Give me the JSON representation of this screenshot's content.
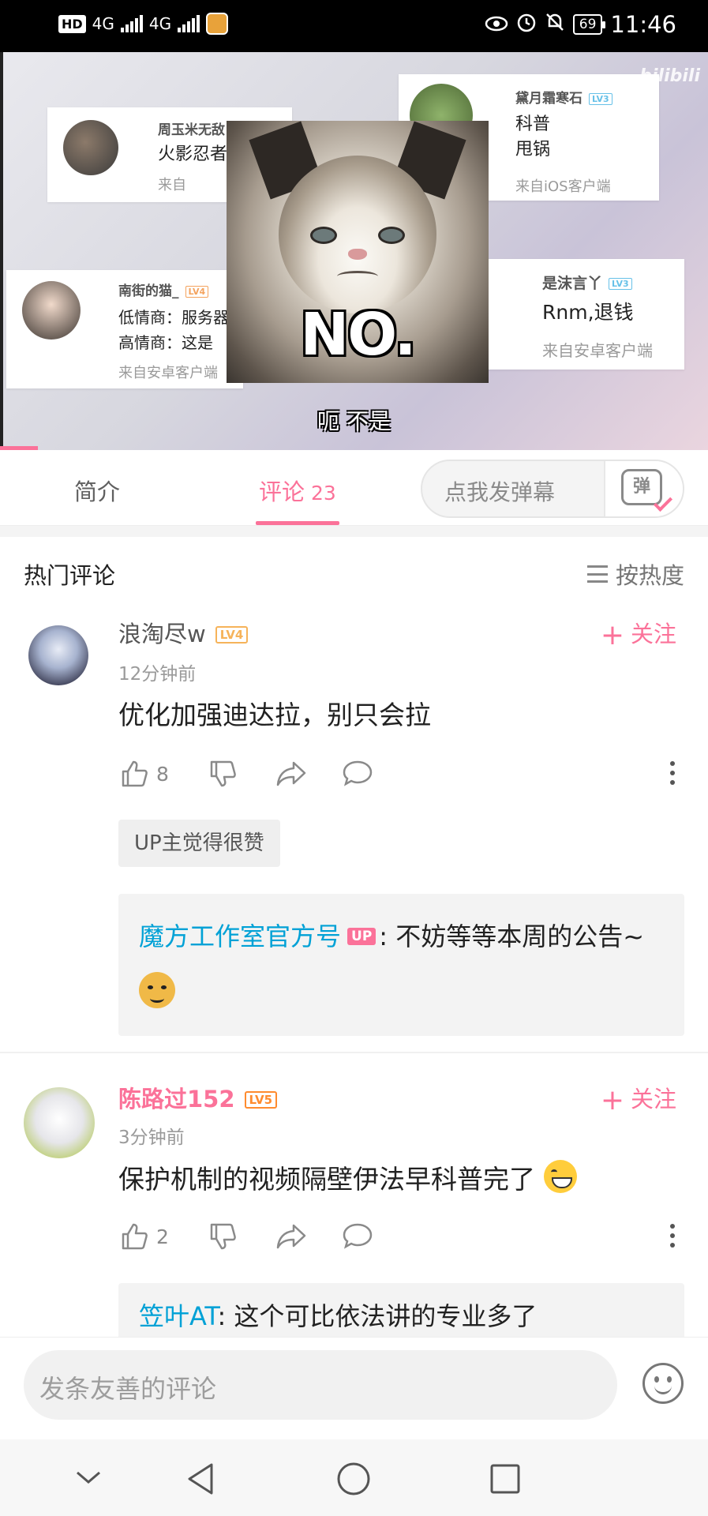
{
  "status_bar": {
    "left_badges": [
      "HD",
      "4G",
      "4G"
    ],
    "battery": "69",
    "time": "11:46",
    "icons": [
      "eye-icon",
      "alarm-icon",
      "bell-off-icon"
    ]
  },
  "video": {
    "subtitle": "呃 不是",
    "watermark": "bilibili",
    "meme_caption": "NO.",
    "progress_fraction": 0.054,
    "overlay_comments": [
      {
        "name": "周玉米无敌",
        "body": "火影忍者",
        "from": "来自"
      },
      {
        "name": "黛月霜寒石",
        "level": "LV3",
        "body_lines": [
          "科普",
          "甩锅"
        ],
        "from": "来自iOS客户端"
      },
      {
        "name": "南街的猫_",
        "level": "LV4",
        "body_lines": [
          "低情商：服务器",
          "高情商：这是"
        ],
        "from": "来自安卓客户端"
      },
      {
        "name": "是沫言丫",
        "level": "LV3",
        "body": "Rnm,退钱",
        "from": "来自安卓客户端"
      }
    ]
  },
  "tabs": {
    "intro": "简介",
    "comments": "评论",
    "comments_count": "23",
    "danmaku_placeholder": "点我发弹幕",
    "danmaku_switch": "弹"
  },
  "comments_header": {
    "title": "热门评论",
    "sort_label": "按热度"
  },
  "comments": [
    {
      "username": "浪淘尽w",
      "level": "LV4",
      "follow_label": "关注",
      "time": "12分钟前",
      "text": "优化加强迪达拉，别只会拉",
      "likes": "8",
      "up_liked": "UP主觉得很赞",
      "reply": {
        "name": "魔方工作室官方号",
        "up_tag": "UP",
        "text": ": 不妨等等本周的公告~"
      }
    },
    {
      "username": "陈路过152",
      "level": "LV5",
      "follow_label": "关注",
      "time": "3分钟前",
      "text": "保护机制的视频隔壁伊法早科普完了",
      "likes": "2",
      "reply": {
        "name": "笠叶AT",
        "text": ": 这个可比依法讲的专业多了"
      }
    }
  ],
  "input_bar": {
    "placeholder": "发条友善的评论"
  },
  "colors": {
    "accent": "#fb7299",
    "link": "#00a1d6",
    "level": "#f6b35a"
  }
}
